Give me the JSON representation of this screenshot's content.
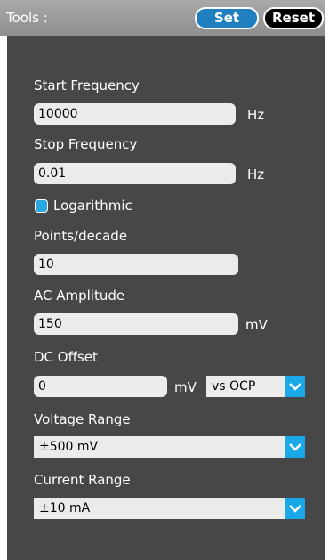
{
  "header": {
    "title": "Tools :",
    "set_label": "Set",
    "reset_label": "Reset"
  },
  "fields": {
    "start_frequency": {
      "label": "Start Frequency",
      "value": "10000",
      "unit": "Hz"
    },
    "stop_frequency": {
      "label": "Stop Frequency",
      "value": "0.01",
      "unit": "Hz"
    },
    "logarithmic": {
      "label": "Logarithmic",
      "checked": true
    },
    "points_per_decade": {
      "label": "Points/decade",
      "value": "10"
    },
    "ac_amplitude": {
      "label": "AC Amplitude",
      "value": "150",
      "unit": "mV"
    },
    "dc_offset": {
      "label": "DC Offset",
      "value": "0",
      "unit": "mV",
      "reference": "vs OCP"
    },
    "voltage_range": {
      "label": "Voltage Range",
      "value": "±500 mV"
    },
    "current_range": {
      "label": "Current Range",
      "value": "±10 mA"
    }
  },
  "colors": {
    "panel_bg": "#474747",
    "accent": "#1aa8e8",
    "set_button": "#1f7fbf",
    "reset_button": "#000000"
  },
  "icons": {
    "dropdown": "chevron-down-icon"
  }
}
